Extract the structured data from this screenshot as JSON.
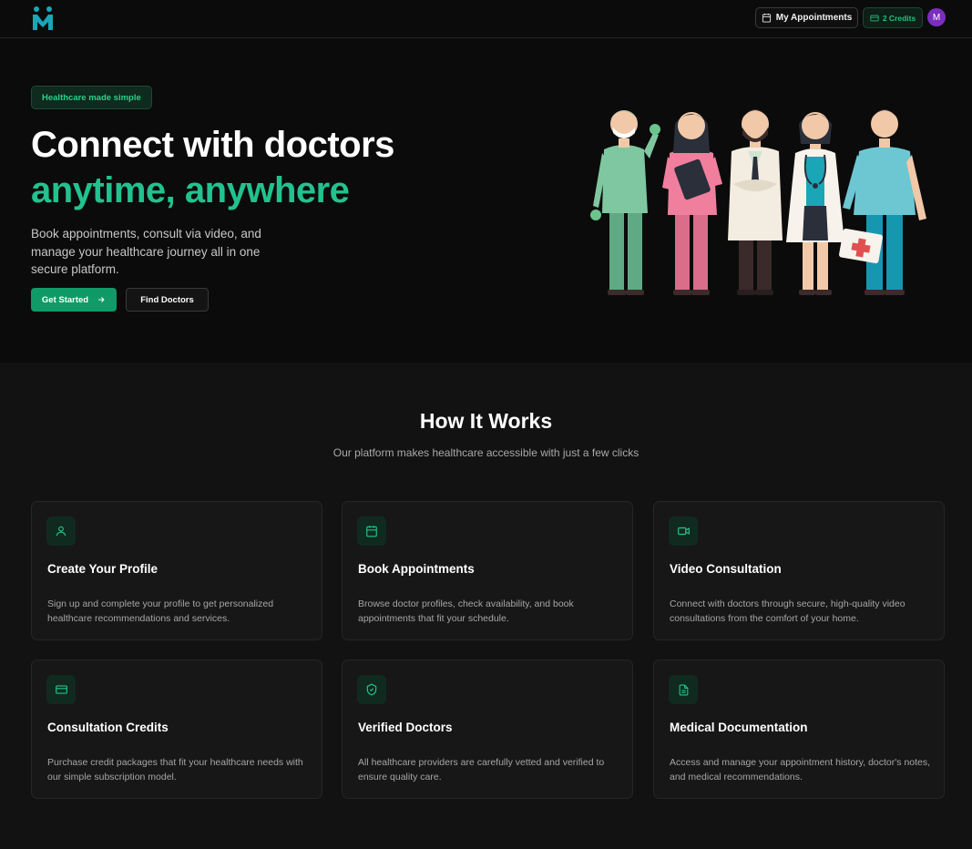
{
  "header": {
    "logo_alt": "MediMeet logo",
    "appointments_label": "My Appointments",
    "credits_label": "2 Credits",
    "avatar_initial": "M"
  },
  "hero": {
    "badge": "Healthcare made simple",
    "title_line1": "Connect with doctors",
    "title_line2": "anytime, anywhere",
    "description": "Book appointments, consult via video, and manage your healthcare journey all in one secure platform.",
    "primary_button": "Get Started",
    "secondary_button": "Find Doctors"
  },
  "how_it_works": {
    "title": "How It Works",
    "subtitle": "Our platform makes healthcare accessible with just a few clicks",
    "cards": [
      {
        "icon": "user-icon",
        "title": "Create Your Profile",
        "description": "Sign up and complete your profile to get personalized healthcare recommendations and services."
      },
      {
        "icon": "calendar-icon",
        "title": "Book Appointments",
        "description": "Browse doctor profiles, check availability, and book appointments that fit your schedule."
      },
      {
        "icon": "video-icon",
        "title": "Video Consultation",
        "description": "Connect with doctors through secure, high-quality video consultations from the comfort of your home."
      },
      {
        "icon": "credit-card-icon",
        "title": "Consultation Credits",
        "description": "Purchase credit packages that fit your healthcare needs with our simple subscription model."
      },
      {
        "icon": "shield-check-icon",
        "title": "Verified Doctors",
        "description": "All healthcare providers are carefully vetted and verified to ensure quality care."
      },
      {
        "icon": "file-text-icon",
        "title": "Medical Documentation",
        "description": "Access and manage your appointment history, doctor's notes, and medical recommendations."
      }
    ]
  },
  "colors": {
    "accent": "#22c28e",
    "primary_button": "#0f9a67",
    "background": "#121212",
    "header_background": "#0b0b0b",
    "card_background": "#171717",
    "avatar": "#7b2ebd"
  }
}
